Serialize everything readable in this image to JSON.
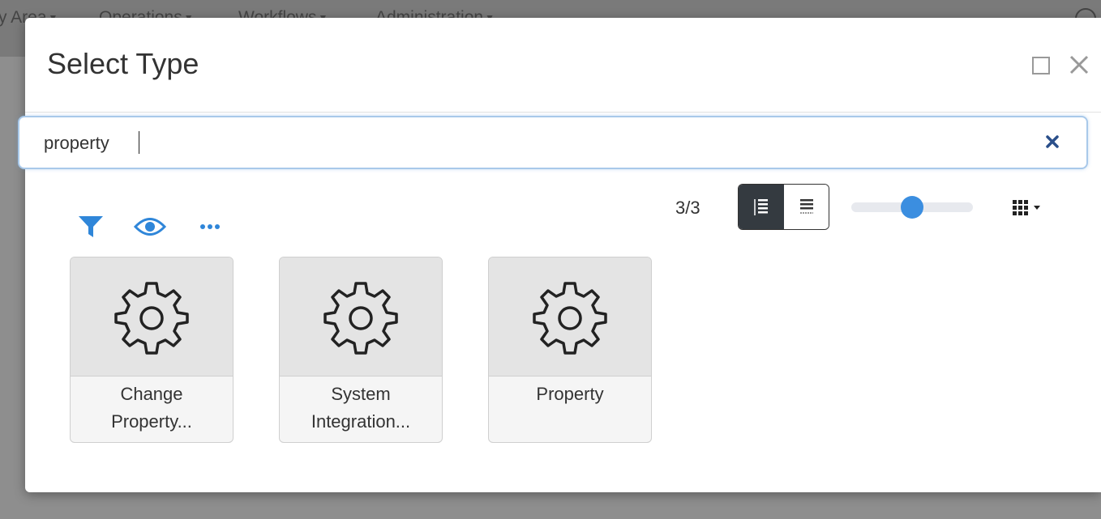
{
  "background_nav": {
    "items": [
      "y Area",
      "Operations",
      "Workflows",
      "Administration"
    ]
  },
  "dialog": {
    "title": "Select Type",
    "maximize_icon": "maximize-icon",
    "close_icon": "close-icon"
  },
  "search": {
    "value": "property",
    "clear_icon": "clear-icon"
  },
  "toolbar": {
    "icons": [
      "filter-icon",
      "eye-icon",
      "more-icon"
    ],
    "result_count": "3/3",
    "view_modes": [
      "list-view",
      "compact-view"
    ],
    "active_view": "list-view",
    "zoom_level": 0.5,
    "grid_menu_icon": "grid-icon"
  },
  "results": [
    {
      "icon": "gear-icon",
      "line1": "Change",
      "line2": "Property..."
    },
    {
      "icon": "gear-icon",
      "line1": "System",
      "line2": "Integration..."
    },
    {
      "icon": "gear-icon",
      "line1": "Property",
      "line2": ""
    }
  ],
  "colors": {
    "accent": "#2f86d9",
    "slider": "#3b8ee0",
    "toggle_active": "#343a40",
    "overlay": "#8e8e8e"
  }
}
